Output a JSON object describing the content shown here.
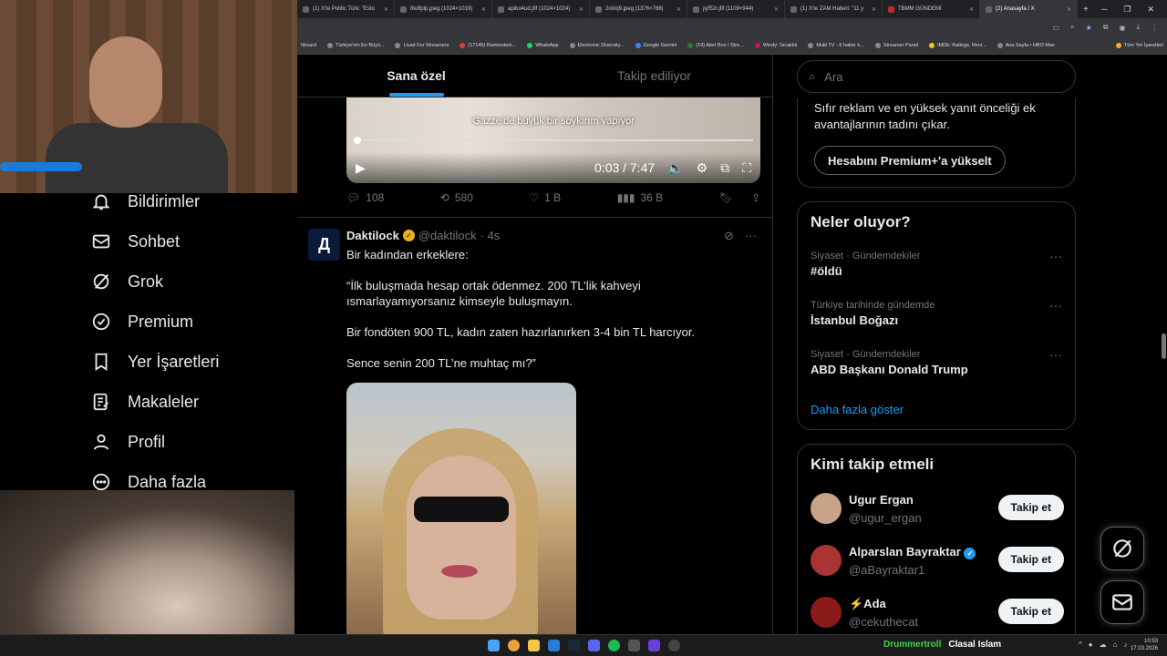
{
  "browser": {
    "tabs": [
      {
        "label": "(1) X'te Politic Türk: \"Esto"
      },
      {
        "label": "8kdfplp.jpeg (1024×1019)"
      },
      {
        "label": "apibo4ud.jfif (1024×1024)"
      },
      {
        "label": "2o0oj9.jpeg (1376×768)"
      },
      {
        "label": "jiyf52r.jfif (1109×944)"
      },
      {
        "label": "(1) X'te ZAM Haberi: \"11 y"
      },
      {
        "label": "TBMM GÜNDEMİ"
      },
      {
        "label": "(2) Anasayfa / X"
      }
    ],
    "bookmarks": [
      "hboard",
      "Türkiye'nin En Büyü...",
      "Livad For Streamers",
      "(17145) Rammstein...",
      "WhatsApp",
      "Electronic Diversity...",
      "Google Gemini",
      "(19) Alert Box / Stre...",
      "Windy: Sıcaklık",
      "Multi TV - 6 haber k...",
      "Streamer Panel",
      "IMDb: Ratings, Revi...",
      "Ana Sayfa • HBO Max",
      "Tüm Yer İşaretleri"
    ]
  },
  "sidebar": {
    "items": [
      {
        "label": "Bildirimler",
        "icon": "bell-icon"
      },
      {
        "label": "Sohbet",
        "icon": "mail-icon"
      },
      {
        "label": "Grok",
        "icon": "grok-icon"
      },
      {
        "label": "Premium",
        "icon": "verified-icon"
      },
      {
        "label": "Yer İşaretleri",
        "icon": "bookmark-icon"
      },
      {
        "label": "Makaleler",
        "icon": "article-icon"
      },
      {
        "label": "Profil",
        "icon": "person-icon"
      },
      {
        "label": "Daha fazla",
        "icon": "more-circle-icon"
      }
    ]
  },
  "feed": {
    "tabs": [
      "Sana özel",
      "Takip ediliyor"
    ],
    "post1": {
      "video_caption": "Gazze'de büyük bir soykırım yapıyor",
      "video_time": "0:03 / 7:47",
      "replies": "108",
      "reposts": "580",
      "likes": "1 B",
      "views": "36 B"
    },
    "post2": {
      "avatar_letter": "Д",
      "name": "Daktilock",
      "handle": "@daktilock",
      "time": "· 4s",
      "body": "Bir kadından erkeklere:\n\n“İlk buluşmada hesap ortak ödenmez. 200 TL’lik kahveyi ısmarlayamıyorsanız kimseyle buluşmayın.\n\nBir fondöten 900 TL, kadın zaten hazırlanırken 3-4 bin TL harcıyor.\n\nSence senin 200 TL’ne muhtaç mı?”"
    }
  },
  "right": {
    "search_placeholder": "Ara",
    "premium_text": "Sıfır reklam ve en yüksek yanıt önceliği ek avantajlarının tadını çıkar.",
    "premium_button": "Hesabını Premium+'a yükselt",
    "trends_title": "Neler oluyor?",
    "trends": [
      {
        "category": "Siyaset · Gündemdekiler",
        "title": "#öldü"
      },
      {
        "category": "Türkiye tarihinde gündemde",
        "title": "İstanbul Boğazı"
      },
      {
        "category": "Siyaset · Gündemdekiler",
        "title": "ABD Başkanı Donald Trump"
      }
    ],
    "show_more": "Daha fazla göster",
    "follow_title": "Kimi takip etmeli",
    "follow": [
      {
        "name": "Ugur Ergan",
        "handle": "@ugur_ergan",
        "button": "Takip et"
      },
      {
        "name": "Alparslan Bayraktar",
        "handle": "@aBayraktar1",
        "button": "Takip et"
      },
      {
        "name": "⚡Ada",
        "handle": "@cekuthecat",
        "button": "Takip et"
      }
    ]
  },
  "taskbar": {
    "user1": "Drummertroll",
    "user2": "Clasal Islam",
    "time": "10:53",
    "date": "17.03.2026"
  },
  "colors": {
    "accent": "#1d9bf0",
    "background": "#000000",
    "border": "#2f3336",
    "muted": "#71767b"
  }
}
